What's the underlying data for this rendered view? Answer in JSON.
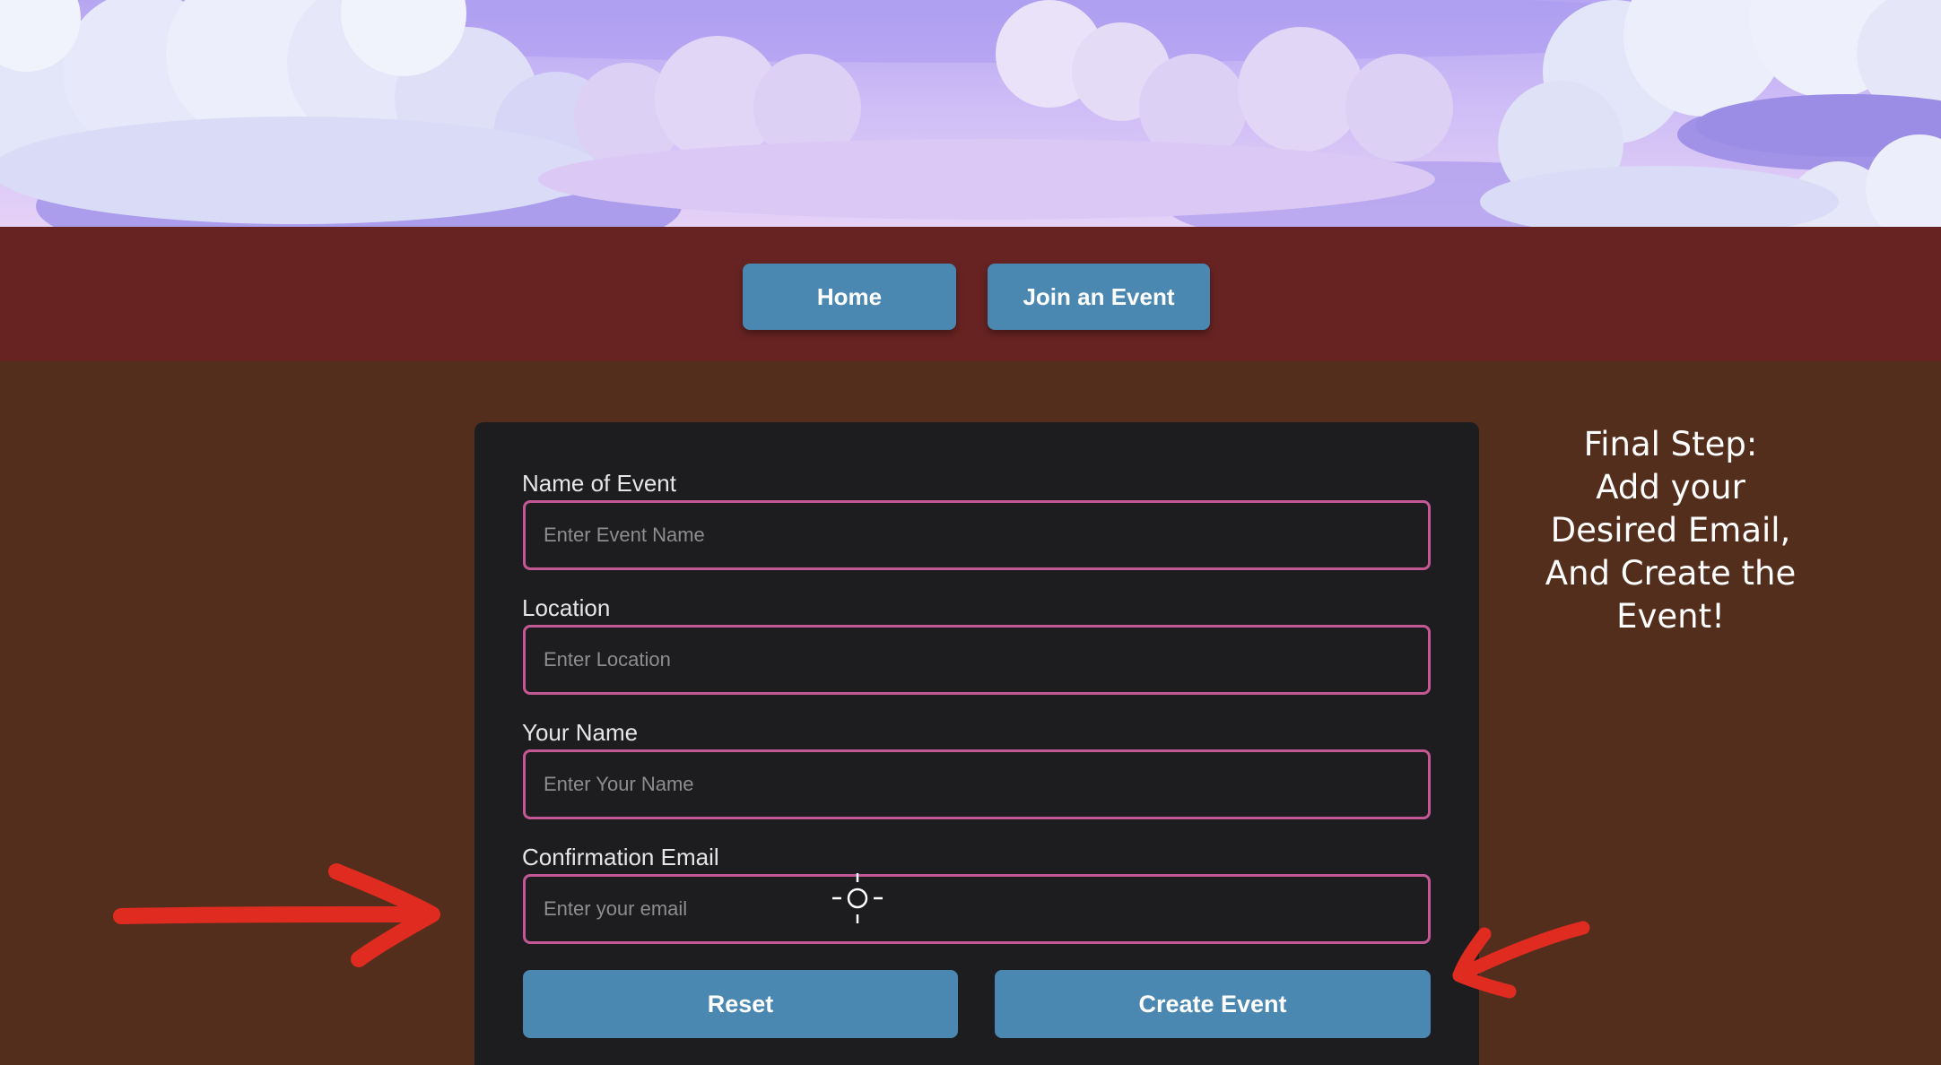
{
  "nav": {
    "home_label": "Home",
    "join_label": "Join an Event"
  },
  "form": {
    "fields": [
      {
        "label": "Name of Event",
        "placeholder": "Enter Event Name",
        "value": ""
      },
      {
        "label": "Location",
        "placeholder": "Enter Location",
        "value": ""
      },
      {
        "label": "Your Name",
        "placeholder": "Enter Your Name",
        "value": ""
      },
      {
        "label": "Confirmation Email",
        "placeholder": "Enter your email",
        "value": ""
      }
    ],
    "reset_label": "Reset",
    "create_label": "Create Event"
  },
  "hint": {
    "lines": [
      "Final Step:",
      "Add your",
      "Desired Email,",
      "And Create the",
      "Event!"
    ]
  },
  "colors": {
    "sky": "#c6b6f4",
    "navbar": "#672322",
    "background": "#542e1d",
    "card": "#1d1d20",
    "button": "#4a88b1",
    "input_border": "#c45896",
    "annotation_arrow": "#e02b20"
  },
  "icons": [
    "red-arrow-right-icon",
    "red-arrow-left-icon",
    "crosshair-cursor-icon"
  ]
}
